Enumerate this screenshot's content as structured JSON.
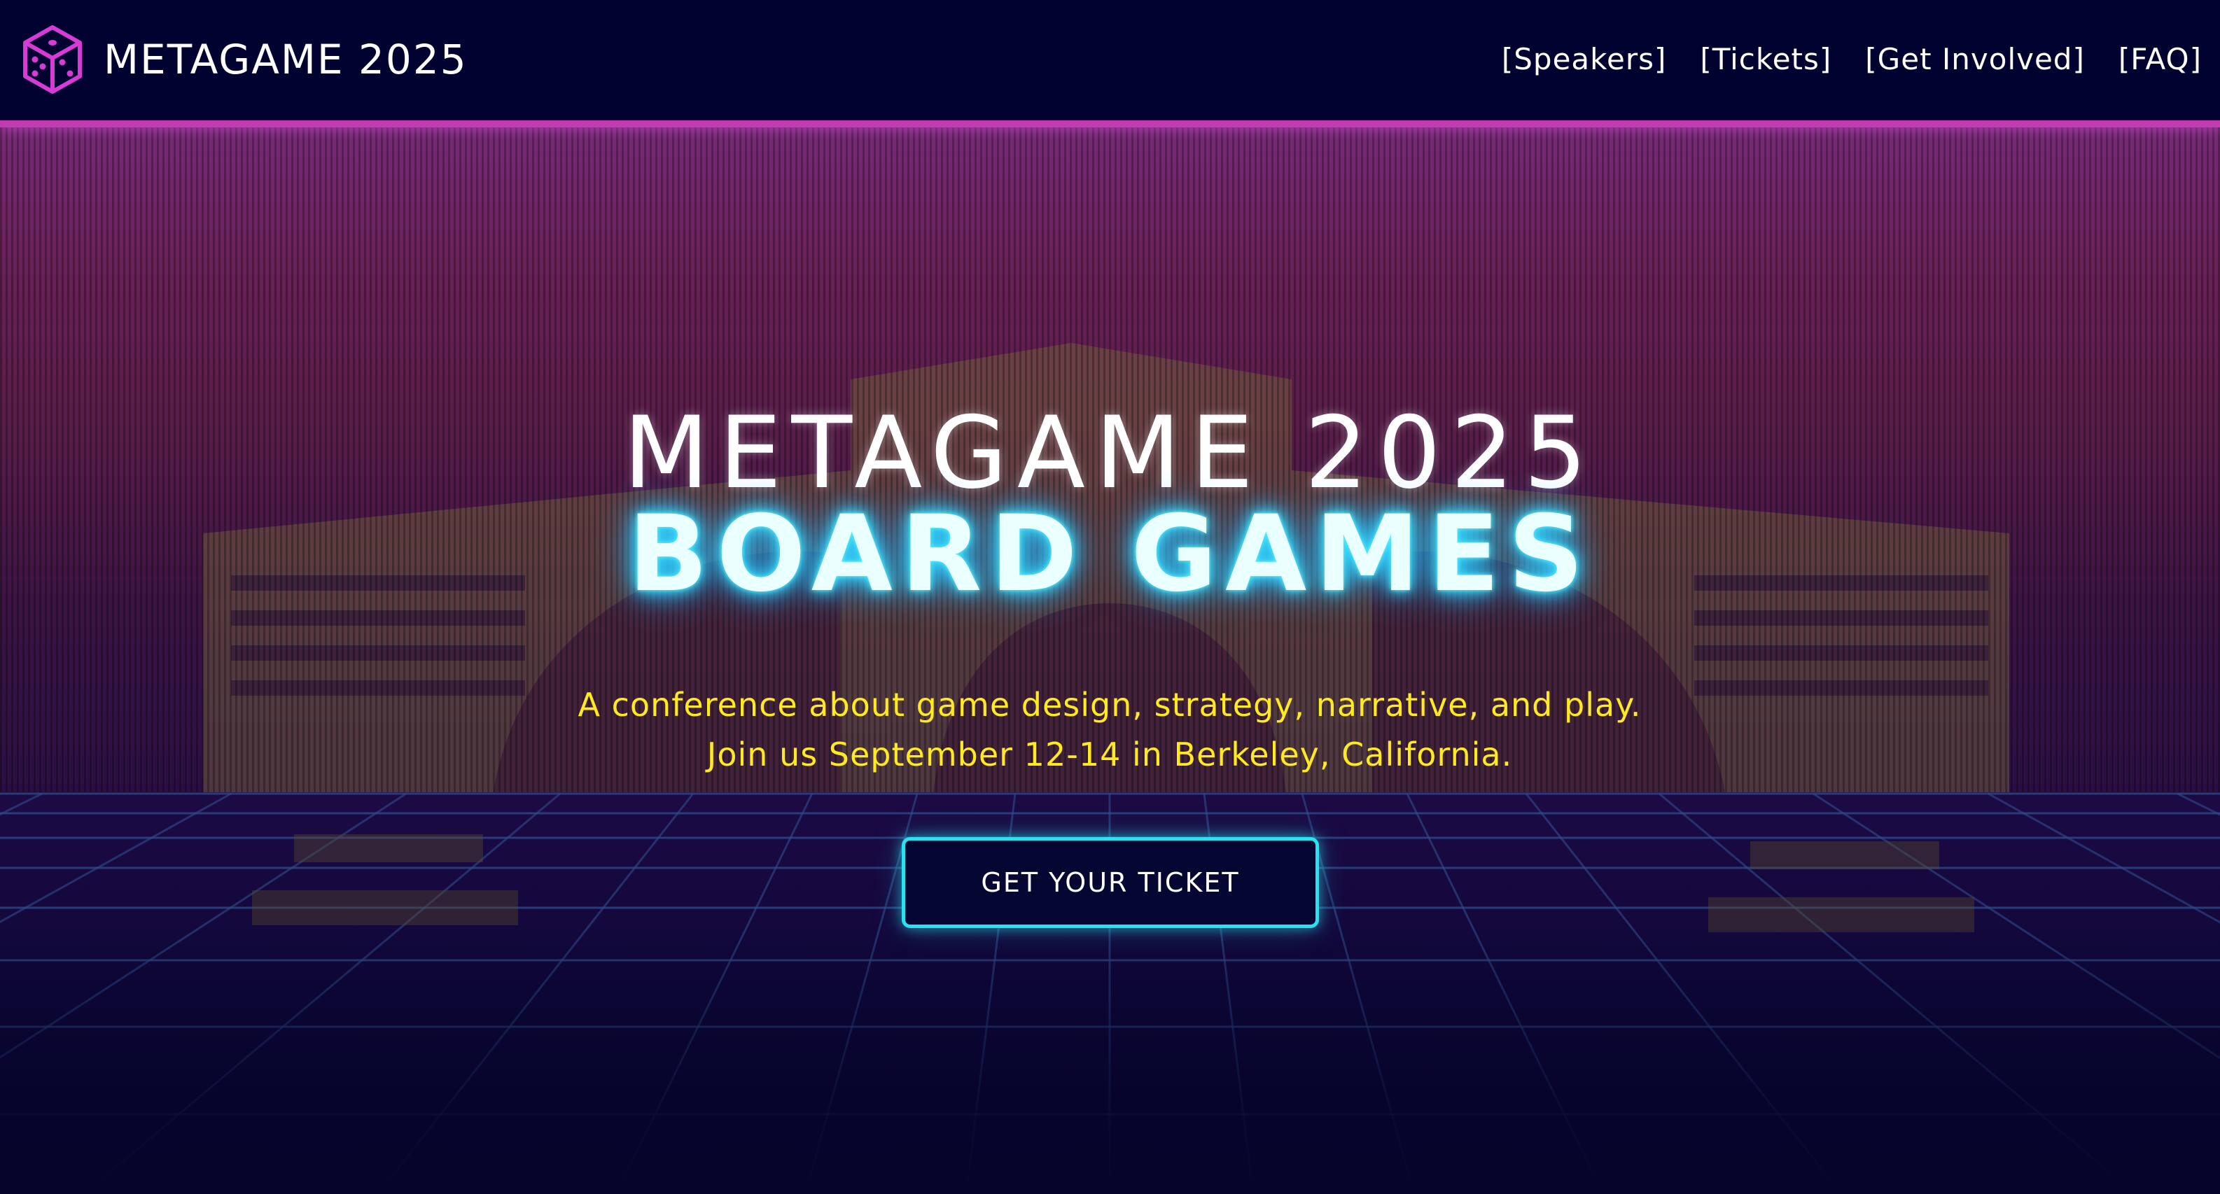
{
  "nav": {
    "brand": "METAGAME 2025",
    "logo_icon": "dice-icon",
    "links": [
      {
        "label": "[Speakers]"
      },
      {
        "label": "[Tickets]"
      },
      {
        "label": "[Get Involved]"
      },
      {
        "label": "[FAQ]"
      }
    ]
  },
  "hero": {
    "title_line1": "METAGAME 2025",
    "title_line2": "BOARD GAMES",
    "description": "A conference about game design, strategy, narrative, and play. Join us September 12-14 in Berkeley, California.",
    "cta_label": "GET YOUR TICKET"
  },
  "colors": {
    "nav_background": "#020230",
    "accent_magenta": "#c33bb0",
    "accent_cyan": "#29e1ef",
    "description_yellow": "#ffe91f",
    "page_background": "#05042b"
  }
}
